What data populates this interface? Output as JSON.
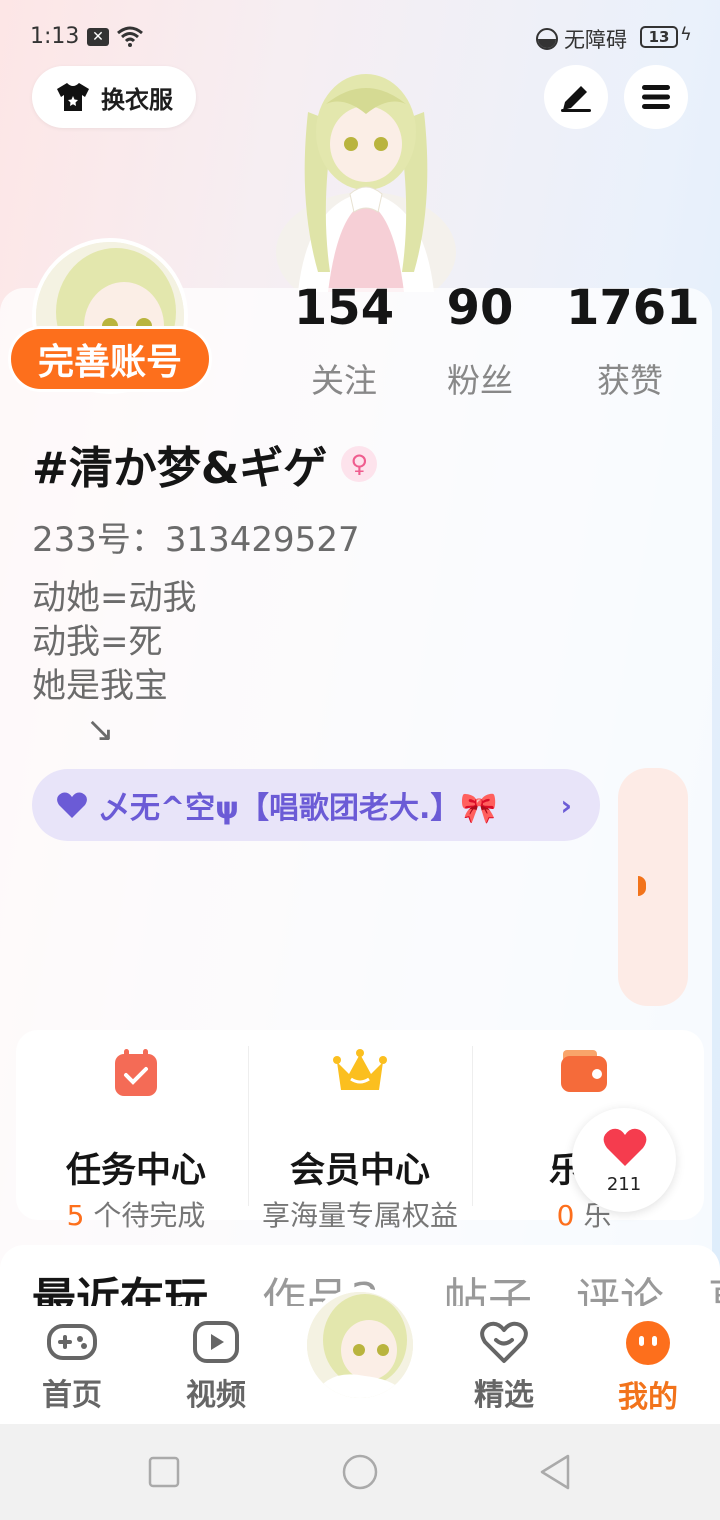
{
  "status_bar": {
    "time": "1:13",
    "accessibility": "无障碍",
    "battery": "13"
  },
  "header": {
    "outfit_label": "换衣服"
  },
  "profile": {
    "complete_label": "完善账号",
    "stats": [
      {
        "value": "154",
        "label": "关注"
      },
      {
        "value": "90",
        "label": "粉丝"
      },
      {
        "value": "1761",
        "label": "获赞"
      }
    ],
    "nickname": "#清か梦&ギゲ",
    "gender_symbol": "♀",
    "uid": "233号：313429527",
    "bio": "动她=动我\n动我=死\n她是我宝\n     ↘",
    "guild": "乄无^空ψ【唱歌团老大.】🎀"
  },
  "entries": [
    {
      "title": "任务中心",
      "highlight": "5",
      "subtitle": " 个待完成"
    },
    {
      "title": "会员中心",
      "highlight": "",
      "subtitle": "享海量专属权益"
    },
    {
      "title": "乐币",
      "highlight": "0",
      "subtitle": " 乐"
    }
  ],
  "likes_count": "211",
  "tabs": [
    "最近在玩",
    "作品Ƨ",
    "帖子",
    "评论",
    "草"
  ],
  "bottom_nav": [
    {
      "label": "首页"
    },
    {
      "label": "视频"
    },
    {
      "label": "精选"
    },
    {
      "label": "我的"
    }
  ],
  "colors": {
    "accent": "#fd6f1c",
    "guild_text": "#6b5bd6",
    "guild_bg": "#e8e4f9"
  }
}
